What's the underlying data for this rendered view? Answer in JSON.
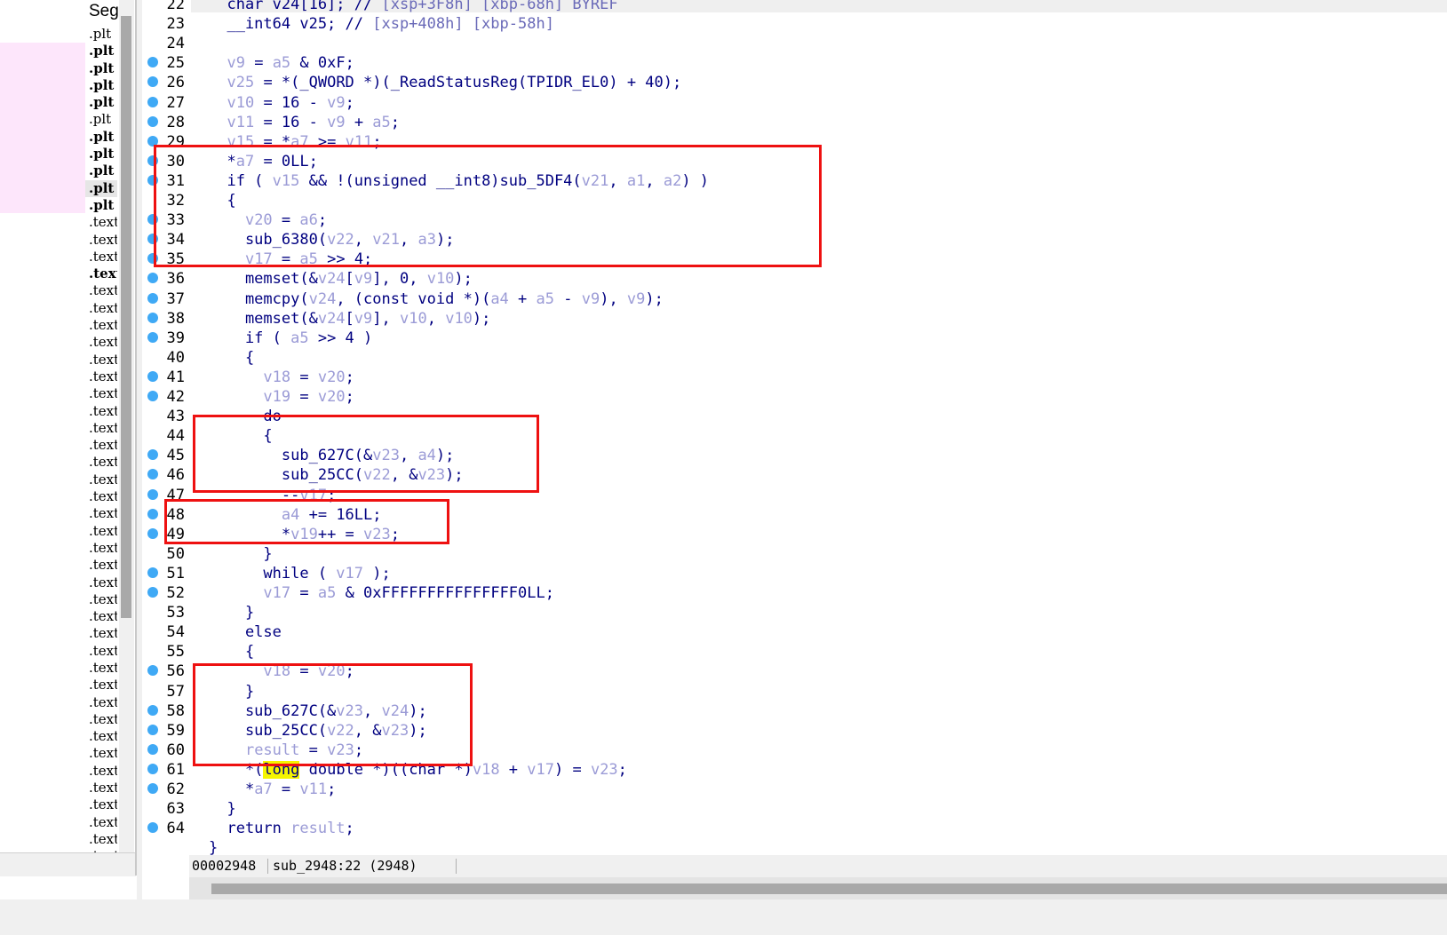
{
  "segments": {
    "header": "Seg",
    "items": [
      {
        "label": ".plt",
        "bold": false
      },
      {
        "label": ".plt",
        "bold": true
      },
      {
        "label": ".plt",
        "bold": true
      },
      {
        "label": ".plt",
        "bold": true
      },
      {
        "label": ".plt",
        "bold": true
      },
      {
        "label": ".plt",
        "bold": false
      },
      {
        "label": ".plt",
        "bold": true
      },
      {
        "label": ".plt",
        "bold": true
      },
      {
        "label": ".plt",
        "bold": true
      },
      {
        "label": ".plt",
        "bold": true
      },
      {
        "label": ".plt",
        "bold": true
      },
      {
        "label": ".text",
        "bold": false
      },
      {
        "label": ".text",
        "bold": false
      },
      {
        "label": ".text",
        "bold": false
      },
      {
        "label": ".text",
        "bold": true
      },
      {
        "label": ".text",
        "bold": false
      },
      {
        "label": ".text",
        "bold": false
      },
      {
        "label": ".text",
        "bold": false
      },
      {
        "label": ".text",
        "bold": false
      },
      {
        "label": ".text",
        "bold": false
      },
      {
        "label": ".text",
        "bold": false
      },
      {
        "label": ".text",
        "bold": false
      },
      {
        "label": ".text",
        "bold": false
      },
      {
        "label": ".text",
        "bold": false
      },
      {
        "label": ".text",
        "bold": false
      },
      {
        "label": ".text",
        "bold": false
      },
      {
        "label": ".text",
        "bold": false
      },
      {
        "label": ".text",
        "bold": false
      },
      {
        "label": ".text",
        "bold": false
      },
      {
        "label": ".text",
        "bold": false
      },
      {
        "label": ".text",
        "bold": false
      },
      {
        "label": ".text",
        "bold": false
      },
      {
        "label": ".text",
        "bold": false
      },
      {
        "label": ".text",
        "bold": false
      },
      {
        "label": ".text",
        "bold": false
      },
      {
        "label": ".text",
        "bold": false
      },
      {
        "label": ".text",
        "bold": false
      },
      {
        "label": ".text",
        "bold": false
      },
      {
        "label": ".text",
        "bold": false
      },
      {
        "label": ".text",
        "bold": false
      },
      {
        "label": ".text",
        "bold": false
      },
      {
        "label": ".text",
        "bold": false
      },
      {
        "label": ".text",
        "bold": false
      },
      {
        "label": ".text",
        "bold": false
      },
      {
        "label": ".text",
        "bold": false
      },
      {
        "label": ".text",
        "bold": false
      },
      {
        "label": ".text",
        "bold": false
      },
      {
        "label": ".text",
        "bold": false
      },
      {
        "label": ".text",
        "bold": false
      }
    ]
  },
  "code_lines": [
    {
      "num": "22",
      "bp": false,
      "tokens": [
        [
          "t",
          "  char v24[16]; // "
        ],
        [
          "c",
          "[xsp+3F8h] [xbp-68h] BYREF"
        ]
      ]
    },
    {
      "num": "23",
      "bp": false,
      "tokens": [
        [
          "t",
          "  __int64 v25; // "
        ],
        [
          "c",
          "[xsp+408h] [xbp-58h]"
        ]
      ]
    },
    {
      "num": "24",
      "bp": false,
      "tokens": []
    },
    {
      "num": "25",
      "bp": true,
      "tokens": [
        [
          "t",
          "  "
        ],
        [
          "v",
          "v9"
        ],
        [
          "t",
          " = "
        ],
        [
          "v",
          "a5"
        ],
        [
          "t",
          " & 0xF;"
        ]
      ]
    },
    {
      "num": "26",
      "bp": true,
      "tokens": [
        [
          "t",
          "  "
        ],
        [
          "v",
          "v25"
        ],
        [
          "t",
          " = *(_QWORD *)(_ReadStatusReg(TPIDR_EL0) + 40);"
        ]
      ]
    },
    {
      "num": "27",
      "bp": true,
      "tokens": [
        [
          "t",
          "  "
        ],
        [
          "v",
          "v10"
        ],
        [
          "t",
          " = 16 - "
        ],
        [
          "v",
          "v9"
        ],
        [
          "t",
          ";"
        ]
      ]
    },
    {
      "num": "28",
      "bp": true,
      "tokens": [
        [
          "t",
          "  "
        ],
        [
          "v",
          "v11"
        ],
        [
          "t",
          " = 16 - "
        ],
        [
          "v",
          "v9"
        ],
        [
          "t",
          " + "
        ],
        [
          "v",
          "a5"
        ],
        [
          "t",
          ";"
        ]
      ]
    },
    {
      "num": "29",
      "bp": true,
      "tokens": [
        [
          "t",
          "  "
        ],
        [
          "v",
          "v15"
        ],
        [
          "t",
          " = *"
        ],
        [
          "v",
          "a7"
        ],
        [
          "t",
          " >= "
        ],
        [
          "v",
          "v11"
        ],
        [
          "t",
          ";"
        ]
      ]
    },
    {
      "num": "30",
      "bp": true,
      "tokens": [
        [
          "t",
          "  *"
        ],
        [
          "v",
          "a7"
        ],
        [
          "t",
          " = 0LL;"
        ]
      ]
    },
    {
      "num": "31",
      "bp": true,
      "tokens": [
        [
          "t",
          "  if ( "
        ],
        [
          "v",
          "v15"
        ],
        [
          "t",
          " && !(unsigned __int8)sub_5DF4("
        ],
        [
          "v",
          "v21"
        ],
        [
          "t",
          ", "
        ],
        [
          "v",
          "a1"
        ],
        [
          "t",
          ", "
        ],
        [
          "v",
          "a2"
        ],
        [
          "t",
          ") )"
        ]
      ]
    },
    {
      "num": "32",
      "bp": false,
      "tokens": [
        [
          "t",
          "  {"
        ]
      ]
    },
    {
      "num": "33",
      "bp": true,
      "tokens": [
        [
          "t",
          "    "
        ],
        [
          "v",
          "v20"
        ],
        [
          "t",
          " = "
        ],
        [
          "v",
          "a6"
        ],
        [
          "t",
          ";"
        ]
      ]
    },
    {
      "num": "34",
      "bp": true,
      "tokens": [
        [
          "t",
          "    sub_6380("
        ],
        [
          "v",
          "v22"
        ],
        [
          "t",
          ", "
        ],
        [
          "v",
          "v21"
        ],
        [
          "t",
          ", "
        ],
        [
          "v",
          "a3"
        ],
        [
          "t",
          ");"
        ]
      ]
    },
    {
      "num": "35",
      "bp": true,
      "tokens": [
        [
          "t",
          "    "
        ],
        [
          "v",
          "v17"
        ],
        [
          "t",
          " = "
        ],
        [
          "v",
          "a5"
        ],
        [
          "t",
          " >> 4;"
        ]
      ]
    },
    {
      "num": "36",
      "bp": true,
      "tokens": [
        [
          "t",
          "    memset(&"
        ],
        [
          "v",
          "v24"
        ],
        [
          "t",
          "["
        ],
        [
          "v",
          "v9"
        ],
        [
          "t",
          "], 0, "
        ],
        [
          "v",
          "v10"
        ],
        [
          "t",
          ");"
        ]
      ]
    },
    {
      "num": "37",
      "bp": true,
      "tokens": [
        [
          "t",
          "    memcpy("
        ],
        [
          "v",
          "v24"
        ],
        [
          "t",
          ", (const void *)("
        ],
        [
          "v",
          "a4"
        ],
        [
          "t",
          " + "
        ],
        [
          "v",
          "a5"
        ],
        [
          "t",
          " - "
        ],
        [
          "v",
          "v9"
        ],
        [
          "t",
          "), "
        ],
        [
          "v",
          "v9"
        ],
        [
          "t",
          ");"
        ]
      ]
    },
    {
      "num": "38",
      "bp": true,
      "tokens": [
        [
          "t",
          "    memset(&"
        ],
        [
          "v",
          "v24"
        ],
        [
          "t",
          "["
        ],
        [
          "v",
          "v9"
        ],
        [
          "t",
          "], "
        ],
        [
          "v",
          "v10"
        ],
        [
          "t",
          ", "
        ],
        [
          "v",
          "v10"
        ],
        [
          "t",
          ");"
        ]
      ]
    },
    {
      "num": "39",
      "bp": true,
      "tokens": [
        [
          "t",
          "    if ( "
        ],
        [
          "v",
          "a5"
        ],
        [
          "t",
          " >> 4 )"
        ]
      ]
    },
    {
      "num": "40",
      "bp": false,
      "tokens": [
        [
          "t",
          "    {"
        ]
      ]
    },
    {
      "num": "41",
      "bp": true,
      "tokens": [
        [
          "t",
          "      "
        ],
        [
          "v",
          "v18"
        ],
        [
          "t",
          " = "
        ],
        [
          "v",
          "v20"
        ],
        [
          "t",
          ";"
        ]
      ]
    },
    {
      "num": "42",
      "bp": true,
      "tokens": [
        [
          "t",
          "      "
        ],
        [
          "v",
          "v19"
        ],
        [
          "t",
          " = "
        ],
        [
          "v",
          "v20"
        ],
        [
          "t",
          ";"
        ]
      ]
    },
    {
      "num": "43",
      "bp": false,
      "tokens": [
        [
          "t",
          "      do"
        ]
      ]
    },
    {
      "num": "44",
      "bp": false,
      "tokens": [
        [
          "t",
          "      {"
        ]
      ]
    },
    {
      "num": "45",
      "bp": true,
      "tokens": [
        [
          "t",
          "        sub_627C(&"
        ],
        [
          "v",
          "v23"
        ],
        [
          "t",
          ", "
        ],
        [
          "v",
          "a4"
        ],
        [
          "t",
          ");"
        ]
      ]
    },
    {
      "num": "46",
      "bp": true,
      "tokens": [
        [
          "t",
          "        sub_25CC("
        ],
        [
          "v",
          "v22"
        ],
        [
          "t",
          ", &"
        ],
        [
          "v",
          "v23"
        ],
        [
          "t",
          ");"
        ]
      ]
    },
    {
      "num": "47",
      "bp": true,
      "tokens": [
        [
          "t",
          "        --"
        ],
        [
          "v",
          "v17"
        ],
        [
          "t",
          ";"
        ]
      ]
    },
    {
      "num": "48",
      "bp": true,
      "tokens": [
        [
          "t",
          "        "
        ],
        [
          "v",
          "a4"
        ],
        [
          "t",
          " += 16LL;"
        ]
      ]
    },
    {
      "num": "49",
      "bp": true,
      "tokens": [
        [
          "t",
          "        *"
        ],
        [
          "v",
          "v19"
        ],
        [
          "t",
          "++ = "
        ],
        [
          "v",
          "v23"
        ],
        [
          "t",
          ";"
        ]
      ]
    },
    {
      "num": "50",
      "bp": false,
      "tokens": [
        [
          "t",
          "      }"
        ]
      ]
    },
    {
      "num": "51",
      "bp": true,
      "tokens": [
        [
          "t",
          "      while ( "
        ],
        [
          "v",
          "v17"
        ],
        [
          "t",
          " );"
        ]
      ]
    },
    {
      "num": "52",
      "bp": true,
      "tokens": [
        [
          "t",
          "      "
        ],
        [
          "v",
          "v17"
        ],
        [
          "t",
          " = "
        ],
        [
          "v",
          "a5"
        ],
        [
          "t",
          " & 0xFFFFFFFFFFFFFFF0LL;"
        ]
      ]
    },
    {
      "num": "53",
      "bp": false,
      "tokens": [
        [
          "t",
          "    }"
        ]
      ]
    },
    {
      "num": "54",
      "bp": false,
      "tokens": [
        [
          "t",
          "    else"
        ]
      ]
    },
    {
      "num": "55",
      "bp": false,
      "tokens": [
        [
          "t",
          "    {"
        ]
      ]
    },
    {
      "num": "56",
      "bp": true,
      "tokens": [
        [
          "t",
          "      "
        ],
        [
          "v",
          "v18"
        ],
        [
          "t",
          " = "
        ],
        [
          "v",
          "v20"
        ],
        [
          "t",
          ";"
        ]
      ]
    },
    {
      "num": "57",
      "bp": false,
      "tokens": [
        [
          "t",
          "    }"
        ]
      ]
    },
    {
      "num": "58",
      "bp": true,
      "tokens": [
        [
          "t",
          "    sub_627C(&"
        ],
        [
          "v",
          "v23"
        ],
        [
          "t",
          ", "
        ],
        [
          "v",
          "v24"
        ],
        [
          "t",
          ");"
        ]
      ]
    },
    {
      "num": "59",
      "bp": true,
      "tokens": [
        [
          "t",
          "    sub_25CC("
        ],
        [
          "v",
          "v22"
        ],
        [
          "t",
          ", &"
        ],
        [
          "v",
          "v23"
        ],
        [
          "t",
          ");"
        ]
      ]
    },
    {
      "num": "60",
      "bp": true,
      "tokens": [
        [
          "t",
          "    "
        ],
        [
          "v",
          "result"
        ],
        [
          "t",
          " = "
        ],
        [
          "v",
          "v23"
        ],
        [
          "t",
          ";"
        ]
      ]
    },
    {
      "num": "61",
      "bp": true,
      "tokens": [
        [
          "t",
          "    *("
        ],
        [
          "h",
          "long"
        ],
        [
          "t",
          " double *)((char *)"
        ],
        [
          "v",
          "v18"
        ],
        [
          "t",
          " + "
        ],
        [
          "v",
          "v17"
        ],
        [
          "t",
          ") = "
        ],
        [
          "v",
          "v23"
        ],
        [
          "t",
          ";"
        ]
      ]
    },
    {
      "num": "62",
      "bp": true,
      "tokens": [
        [
          "t",
          "    *"
        ],
        [
          "v",
          "a7"
        ],
        [
          "t",
          " = "
        ],
        [
          "v",
          "v11"
        ],
        [
          "t",
          ";"
        ]
      ]
    },
    {
      "num": "63",
      "bp": false,
      "tokens": [
        [
          "t",
          "  }"
        ]
      ]
    },
    {
      "num": "64",
      "bp": true,
      "tokens": [
        [
          "t",
          "  return "
        ],
        [
          "v",
          "result"
        ],
        [
          "t",
          ";"
        ]
      ]
    },
    {
      "num": "",
      "bp": false,
      "tokens": [
        [
          "t",
          "}"
        ]
      ]
    }
  ],
  "status": {
    "address": "00002948",
    "function": "sub_2948:22 (2948)"
  },
  "colors": {
    "keyword": "#000080",
    "variable": "#9b9bd6",
    "comment": "#6a6ab8",
    "breakpoint": "#3fa9f5",
    "annotation_box": "#ee1111",
    "highlight": "#f5f500"
  }
}
